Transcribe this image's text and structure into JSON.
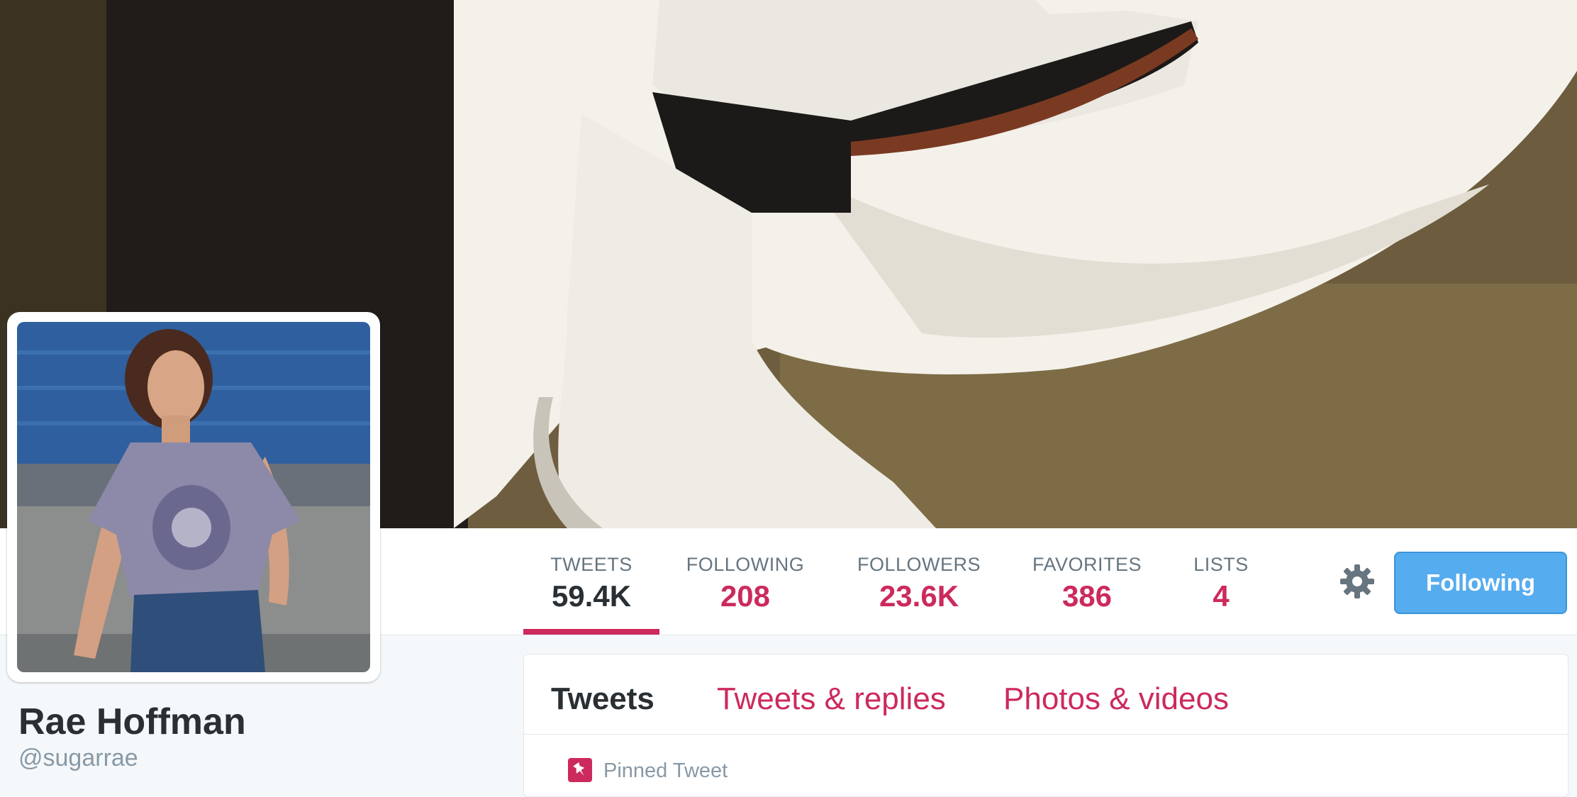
{
  "profile": {
    "name": "Rae Hoffman",
    "handle": "@sugarrae"
  },
  "stats": [
    {
      "label": "TWEETS",
      "value": "59.4K",
      "active": true
    },
    {
      "label": "FOLLOWING",
      "value": "208",
      "active": false
    },
    {
      "label": "FOLLOWERS",
      "value": "23.6K",
      "active": false
    },
    {
      "label": "FAVORITES",
      "value": "386",
      "active": false
    },
    {
      "label": "LISTS",
      "value": "4",
      "active": false
    }
  ],
  "actions": {
    "follow_label": "Following",
    "settings_icon": "gear-icon"
  },
  "timeline": {
    "tabs": [
      {
        "label": "Tweets",
        "active": true
      },
      {
        "label": "Tweets & replies",
        "active": false
      },
      {
        "label": "Photos & videos",
        "active": false
      }
    ],
    "pinned_label": "Pinned Tweet",
    "pinned_icon": "pin-icon"
  },
  "colors": {
    "accent": "#cc2a5c",
    "follow_button": "#55acee",
    "text_dark": "#292f33",
    "text_muted": "#66757f"
  }
}
